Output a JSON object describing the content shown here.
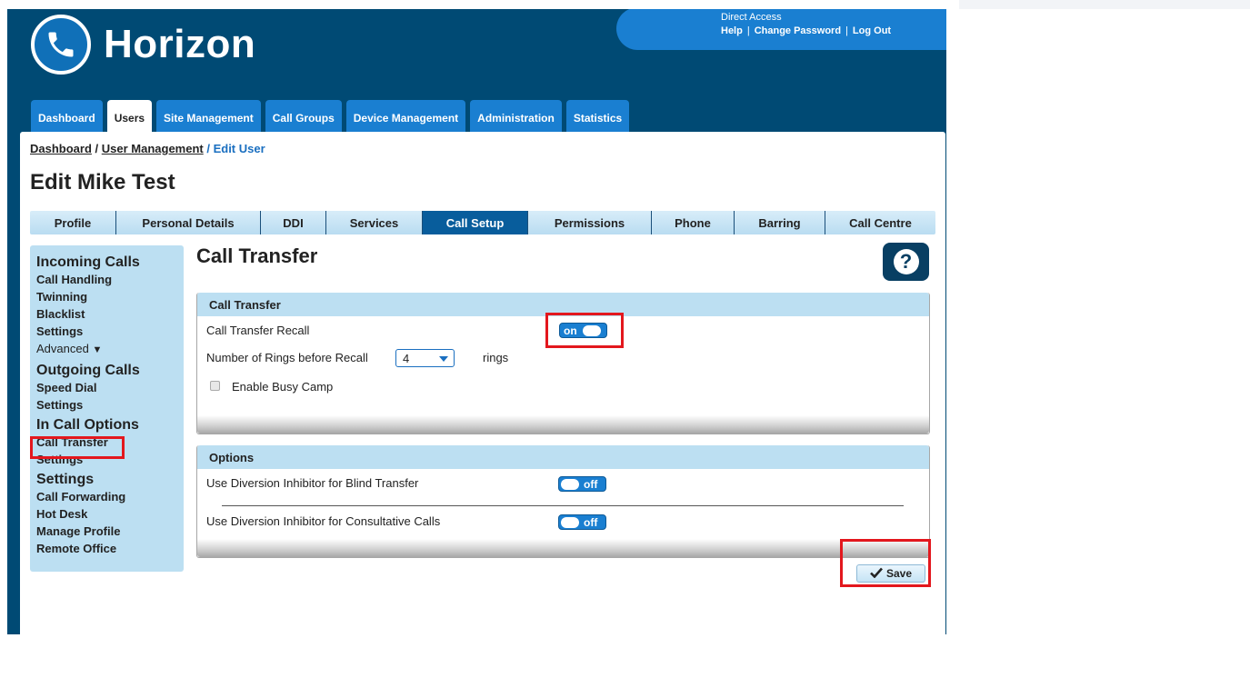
{
  "app": {
    "brand": "Horizon"
  },
  "account": {
    "title": "Direct Access",
    "links": [
      "Help",
      "Change Password",
      "Log Out"
    ]
  },
  "main_tabs": [
    "Dashboard",
    "Users",
    "Site Management",
    "Call Groups",
    "Device Management",
    "Administration",
    "Statistics"
  ],
  "breadcrumb": {
    "item1": "Dashboard",
    "sep1": " / ",
    "item2": "User Management",
    "sep2": " / ",
    "current": "Edit User"
  },
  "page_title": "Edit Mike Test",
  "sub_tabs": [
    "Profile",
    "Personal Details",
    "DDI",
    "Services",
    "Call Setup",
    "Permissions",
    "Phone",
    "Barring",
    "Call Centre"
  ],
  "sidebar": {
    "incoming": {
      "heading": "Incoming Calls",
      "items": [
        "Call Handling",
        "Twinning",
        "Blacklist",
        "Settings",
        "Advanced"
      ]
    },
    "outgoing": {
      "heading": "Outgoing Calls",
      "items": [
        "Speed Dial",
        "Settings"
      ]
    },
    "in_call": {
      "heading": "In Call Options",
      "items": [
        "Call Transfer",
        "Settings"
      ]
    },
    "settings": {
      "heading": "Settings",
      "items": [
        "Call Forwarding",
        "Hot Desk",
        "Manage Profile",
        "Remote Office"
      ]
    }
  },
  "section_title": "Call Transfer",
  "help_label": "?",
  "call_transfer_box": {
    "heading": "Call Transfer",
    "recall_label": "Call Transfer Recall",
    "recall_toggle": "on",
    "rings_label": "Number of Rings before Recall",
    "rings_value": "4",
    "rings_suffix": "rings",
    "busy_camp_label": "Enable Busy Camp",
    "busy_camp_checked": false
  },
  "options_box": {
    "heading": "Options",
    "blind_label": "Use Diversion Inhibitor for Blind Transfer",
    "blind_toggle": "off",
    "consult_label": "Use Diversion Inhibitor for Consultative Calls",
    "consult_toggle": "off"
  },
  "save_label": "Save",
  "colors": {
    "header_bg": "#004a74",
    "tab_blue": "#1a7fd1",
    "active_subtab": "#085d9c",
    "highlight": "#e3171d"
  }
}
